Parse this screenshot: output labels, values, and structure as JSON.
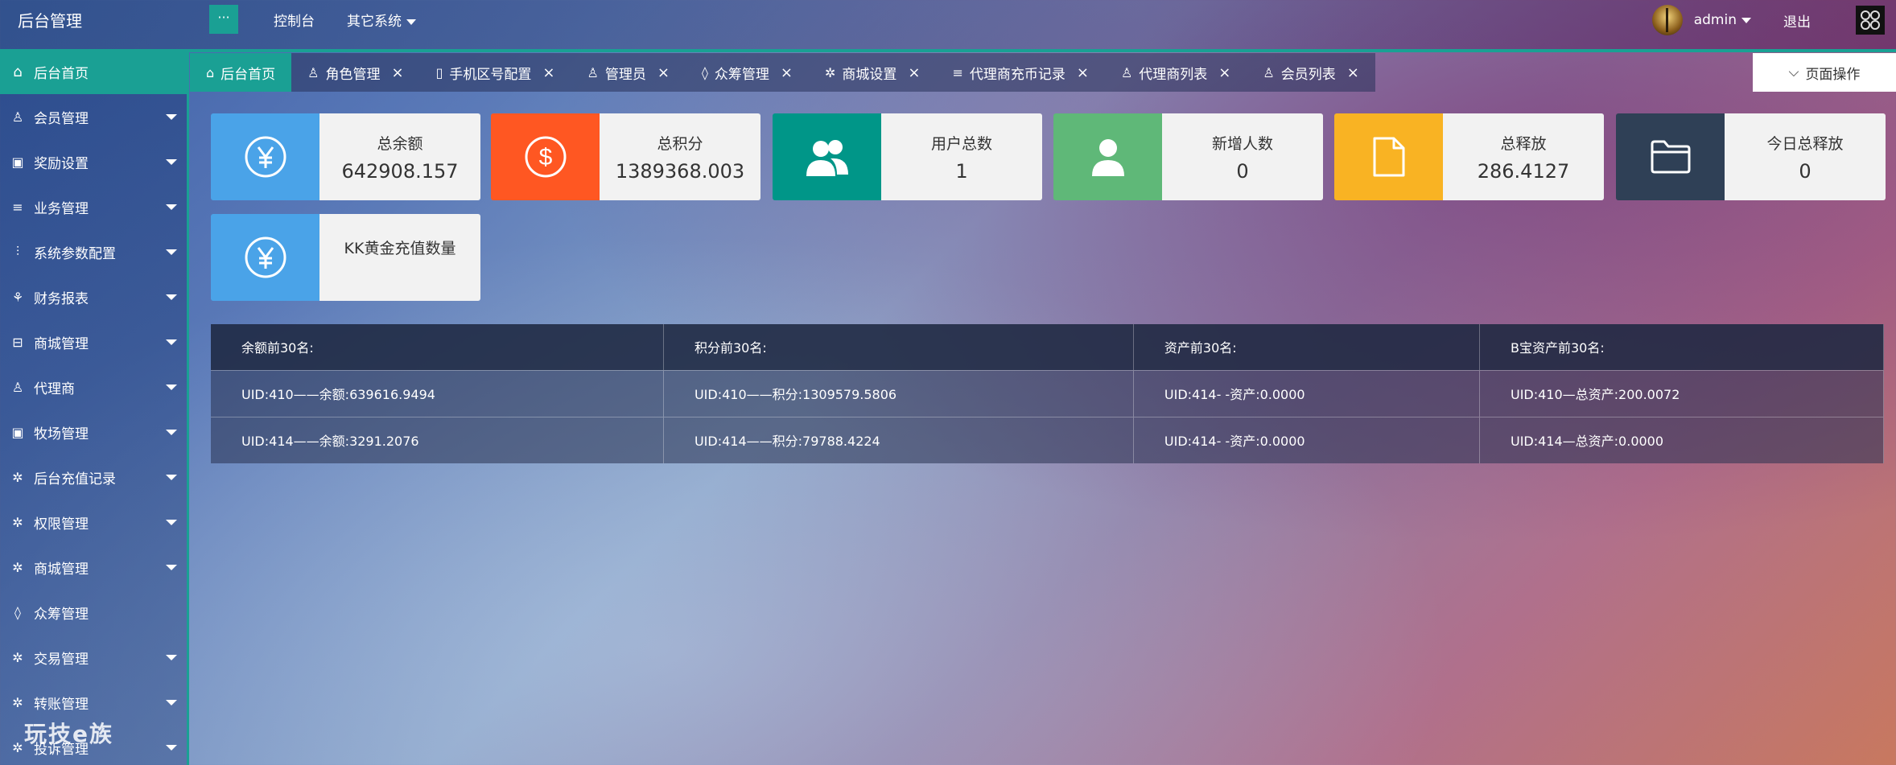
{
  "app": {
    "title": "后台管理"
  },
  "header": {
    "menu_button": "···",
    "nav": [
      "控制台",
      "其它系统"
    ],
    "user": "admin",
    "logout": "退出"
  },
  "sidebar": {
    "home": "后台首页",
    "items": [
      {
        "label": "会员管理",
        "icon": "user-icon"
      },
      {
        "label": "奖励设置",
        "icon": "gift-icon"
      },
      {
        "label": "业务管理",
        "icon": "list-icon"
      },
      {
        "label": "系统参数配置",
        "icon": "sliders-icon"
      },
      {
        "label": "财务报表",
        "icon": "chart-icon"
      },
      {
        "label": "商城管理",
        "icon": "store-icon"
      },
      {
        "label": "代理商",
        "icon": "user-icon"
      },
      {
        "label": "牧场管理",
        "icon": "gift-icon"
      },
      {
        "label": "后台充值记录",
        "icon": "gear-icon"
      },
      {
        "label": "权限管理",
        "icon": "gear-icon"
      },
      {
        "label": "商城管理",
        "icon": "gear-icon"
      },
      {
        "label": "众筹管理",
        "icon": "drops-icon"
      },
      {
        "label": "交易管理",
        "icon": "gear-icon"
      },
      {
        "label": "转账管理",
        "icon": "gear-icon"
      },
      {
        "label": "投诉管理",
        "icon": "gear-icon"
      }
    ],
    "watermark": "玩技e族"
  },
  "tabs": [
    {
      "label": "后台首页",
      "icon": "home-icon",
      "closable": false
    },
    {
      "label": "角色管理",
      "icon": "user-cog-icon",
      "closable": true
    },
    {
      "label": "手机区号配置",
      "icon": "phone-icon",
      "closable": true
    },
    {
      "label": "管理员",
      "icon": "user-icon",
      "closable": true
    },
    {
      "label": "众筹管理",
      "icon": "drops-icon",
      "closable": true
    },
    {
      "label": "商城设置",
      "icon": "gear-icon",
      "closable": true
    },
    {
      "label": "代理商充币记录",
      "icon": "list-icon",
      "closable": true
    },
    {
      "label": "代理商列表",
      "icon": "user-cog-icon",
      "closable": true
    },
    {
      "label": "会员列表",
      "icon": "user-cog-icon",
      "closable": true
    }
  ],
  "page_ops": "页面操作",
  "cards": [
    {
      "label": "总余额",
      "value": "642908.157",
      "icon": "yen-icon",
      "color": "#4aa3e8"
    },
    {
      "label": "总积分",
      "value": "1389368.003",
      "icon": "dollar-icon",
      "color": "#ff5722"
    },
    {
      "label": "用户总数",
      "value": "1",
      "icon": "users-icon",
      "color": "#009688"
    },
    {
      "label": "新增人数",
      "value": "0",
      "icon": "user-icon",
      "color": "#5fb878"
    },
    {
      "label": "总释放",
      "value": "286.4127",
      "icon": "file-icon",
      "color": "#f9b323"
    },
    {
      "label": "今日总释放",
      "value": "0",
      "icon": "folder-icon",
      "color": "#2f4056"
    },
    {
      "label": "KK黄金充值数量",
      "value": "",
      "icon": "yen-icon",
      "color": "#4aa3e8"
    }
  ],
  "rank_table": {
    "headers": [
      "余额前30名:",
      "积分前30名:",
      "资产前30名:",
      "B宝资产前30名:"
    ],
    "rows": [
      [
        "UID:410——余额:639616.9494",
        "UID:410——积分:1309579.5806",
        "UID:414- -资产:0.0000",
        "UID:410—总资产:200.0072"
      ],
      [
        "UID:414——余额:3291.2076",
        "UID:414——积分:79788.4224",
        "UID:414- -资产:0.0000",
        "UID:414—总资产:0.0000"
      ]
    ]
  }
}
